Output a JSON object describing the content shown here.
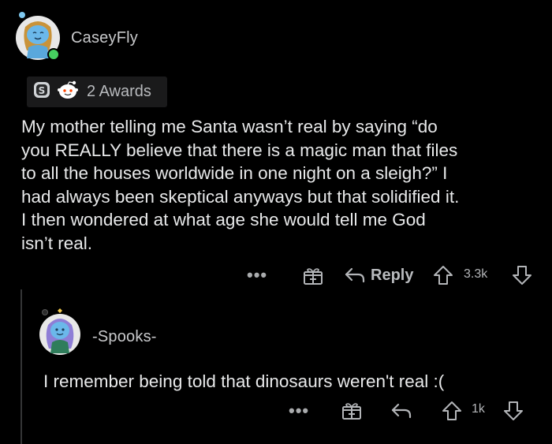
{
  "comment": {
    "username": "CaseyFly",
    "awards": {
      "label": "2 Awards",
      "icons": [
        "silver-award-icon",
        "wholesome-award-icon"
      ]
    },
    "body_lines": [
      "My mother telling me Santa wasn’t real by saying “do",
      "you REALLY believe that there is a magic man that files",
      "to all the houses worldwide in one night on a sleigh?” I",
      "had always been skeptical anyways but that solidified it.",
      "I then wondered at what age she would tell me God",
      "isn’t real."
    ],
    "actions": {
      "more": "•••",
      "reply_label": "Reply",
      "score": "3.3k"
    }
  },
  "reply": {
    "username": "-Spooks-",
    "body": "I remember being told that dinosaurs weren't real :(",
    "actions": {
      "more": "•••",
      "score": "1k"
    }
  },
  "colors": {
    "background": "#000000",
    "text": "#e8e9ea",
    "muted": "#b3b5b8",
    "chip": "#1a1a1b",
    "online": "#46d160",
    "avatar_blue": "#68b8e8",
    "avatar_purple": "#8e7ed6"
  }
}
